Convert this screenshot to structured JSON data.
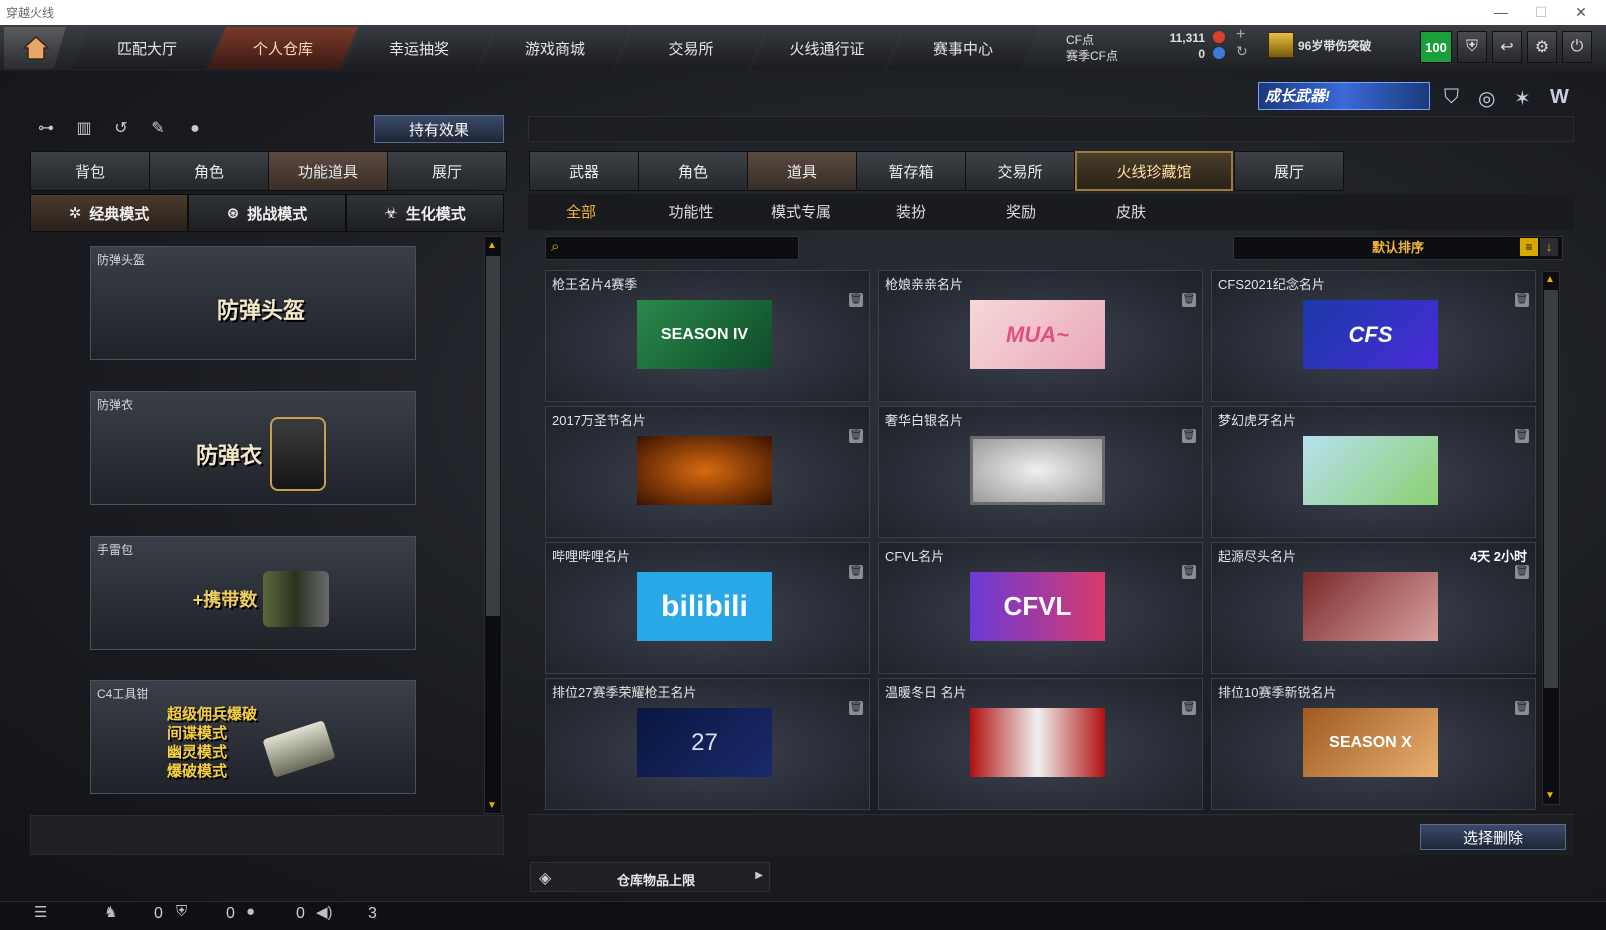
{
  "window": {
    "title": "穿越火线"
  },
  "nav": {
    "tabs": [
      "匹配大厅",
      "个人仓库",
      "幸运抽奖",
      "游戏商城",
      "交易所",
      "火线通行证",
      "赛事中心"
    ],
    "active_index": 1
  },
  "currency": {
    "cf_label": "CF点",
    "cf_value": "11,311",
    "season_label": "赛季CF点",
    "season_value": "0"
  },
  "rank": {
    "text": "96岁带伤突破"
  },
  "level_badge": "100",
  "promo": {
    "text": "成长武器!"
  },
  "left": {
    "effect_button": "持有效果",
    "tabs": [
      "背包",
      "角色",
      "功能道具",
      "展厅"
    ],
    "active_tab": 2,
    "modes": [
      "经典模式",
      "挑战模式",
      "生化模式"
    ],
    "items": [
      {
        "caption": "防弹头盔",
        "art": "防弹头盔"
      },
      {
        "caption": "防弹衣",
        "art": "防弹衣"
      },
      {
        "caption": "手雷包",
        "art": "+携带数"
      },
      {
        "caption": "C4工具钳",
        "art_lines": [
          "超级佣兵爆破",
          "间谍模式",
          "幽灵模式",
          "爆破模式"
        ]
      }
    ]
  },
  "right": {
    "tabs": [
      "武器",
      "角色",
      "道具",
      "暂存箱",
      "交易所",
      "火线珍藏馆",
      "展厅"
    ],
    "active_tab": 2,
    "gold_tab": 5,
    "subtabs": [
      "全部",
      "功能性",
      "模式专属",
      "装扮",
      "奖励",
      "皮肤"
    ],
    "active_subtab": 0,
    "search_placeholder": "",
    "sort_label": "默认排序",
    "cards": [
      {
        "name": "枪王名片4赛季",
        "timer": "",
        "art": "SEASON IV"
      },
      {
        "name": "枪娘亲亲名片",
        "timer": "",
        "art": "MUA~"
      },
      {
        "name": "CFS2021纪念名片",
        "timer": "",
        "art": "CFS"
      },
      {
        "name": "2017万圣节名片",
        "timer": "",
        "art": ""
      },
      {
        "name": "奢华白银名片",
        "timer": "",
        "art": ""
      },
      {
        "name": "梦幻虎牙名片",
        "timer": "",
        "art": ""
      },
      {
        "name": "哔哩哔哩名片",
        "timer": "",
        "art": "bilibili"
      },
      {
        "name": "CFVL名片",
        "timer": "",
        "art": "CFVL"
      },
      {
        "name": "起源尽头名片",
        "timer": "4天 2小时",
        "art": ""
      },
      {
        "name": "排位27赛季荣耀枪王名片",
        "timer": "",
        "art": "27"
      },
      {
        "name": "温暖冬日 名片",
        "timer": "",
        "art": ""
      },
      {
        "name": "排位10赛季新锐名片",
        "timer": "",
        "art": "SEASON X"
      }
    ],
    "delete_button": "选择删除",
    "capacity_label": "仓库物品上限"
  },
  "bottom": {
    "counts": [
      "0",
      "0",
      "0",
      "3"
    ]
  },
  "colors": {
    "accent_gold": "#f0b43a",
    "level_green": "#1aa03a",
    "active_nav": "#7a3a2a"
  }
}
